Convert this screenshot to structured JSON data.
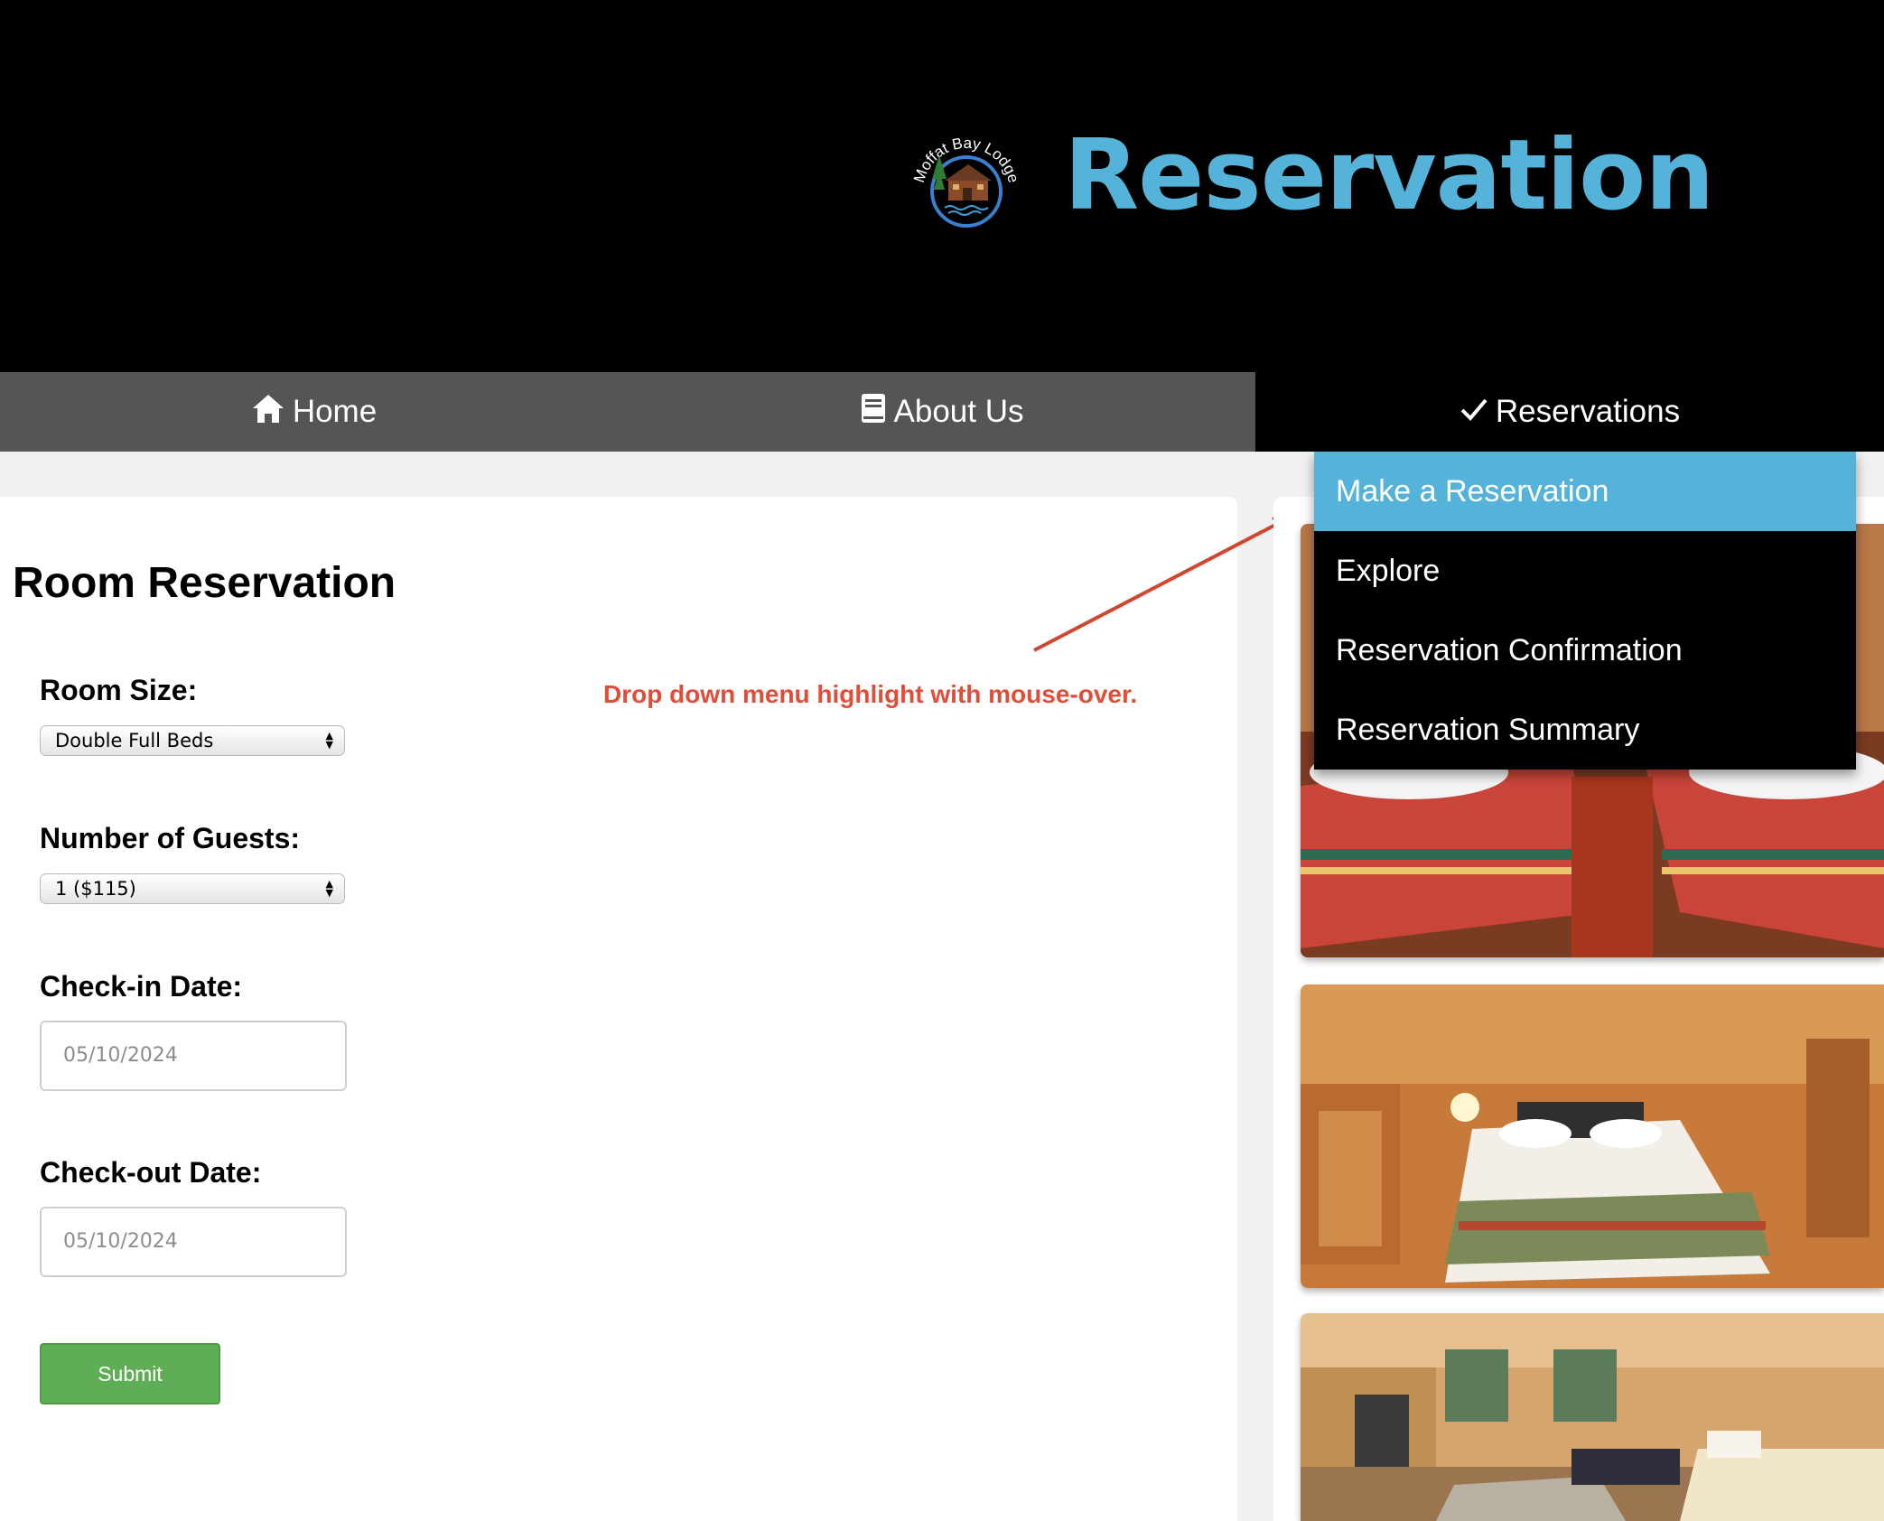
{
  "header": {
    "logo_text": "Moffat Bay Lodge",
    "title": "Reservation",
    "title_color": "#55b3d9"
  },
  "nav": {
    "home": {
      "label": "Home",
      "icon": "home-icon"
    },
    "about": {
      "label": "About Us",
      "icon": "book-icon"
    },
    "reservations": {
      "label": "Reservations",
      "icon": "checkmark-icon"
    }
  },
  "dropdown": {
    "items": [
      {
        "label": "Make a Reservation",
        "highlighted": true
      },
      {
        "label": "Explore"
      },
      {
        "label": "Reservation Confirmation"
      },
      {
        "label": "Reservation Summary"
      }
    ]
  },
  "form": {
    "title": "Room Reservation",
    "room_size_label": "Room Size:",
    "room_size_value": "Double Full Beds",
    "guests_label": "Number of Guests:",
    "guests_value": "1 ($115)",
    "checkin_label": "Check-in Date:",
    "checkin_value": "05/10/2024",
    "checkout_label": "Check-out Date:",
    "checkout_value": "05/10/2024",
    "submit_label": "Submit"
  },
  "annotation": {
    "text": "Drop down menu highlight with mouse-over.",
    "color": "#e04e3a"
  },
  "colors": {
    "header_bg": "#000000",
    "nav_bg": "#555555",
    "accent": "#55b3d9",
    "submit": "#5fae57"
  }
}
